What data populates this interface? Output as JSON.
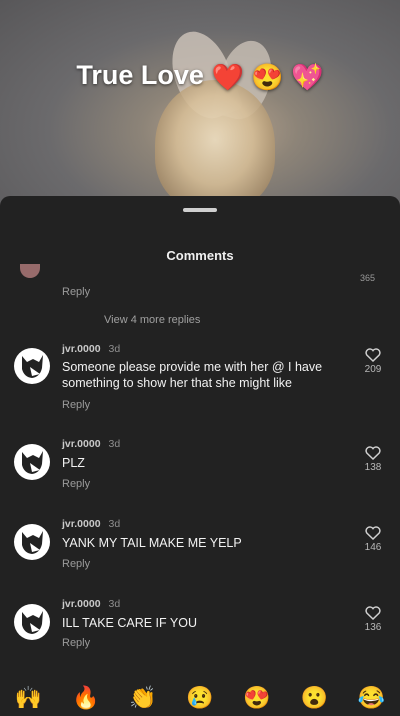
{
  "video": {
    "title": "True Love",
    "title_emojis": [
      "❤️",
      "😍",
      "💖"
    ]
  },
  "comments_panel": {
    "title": "Comments",
    "partial_comment": {
      "like_count": "365",
      "reply_label": "Reply"
    },
    "view_more_label": "View 4 more replies",
    "comments": [
      {
        "username": "jvr.0000",
        "ago": "3d",
        "text": "Someone please provide me with her @ I have something to show her that she might like",
        "reply_label": "Reply",
        "likes": "209"
      },
      {
        "username": "jvr.0000",
        "ago": "3d",
        "text": "PLZ",
        "reply_label": "Reply",
        "likes": "138"
      },
      {
        "username": "jvr.0000",
        "ago": "3d",
        "text": "YANK MY TAIL MAKE ME YELP",
        "reply_label": "Reply",
        "likes": "146"
      },
      {
        "username": "jvr.0000",
        "ago": "3d",
        "text": "ILL TAKE CARE IF YOU",
        "reply_label": "Reply",
        "likes": "136"
      }
    ]
  },
  "emoji_bar": [
    "🙌",
    "🔥",
    "👏",
    "😢",
    "😍",
    "😮",
    "😂"
  ],
  "colors": {
    "sheet_bg": "#222222",
    "video_text": "#ffffff"
  }
}
